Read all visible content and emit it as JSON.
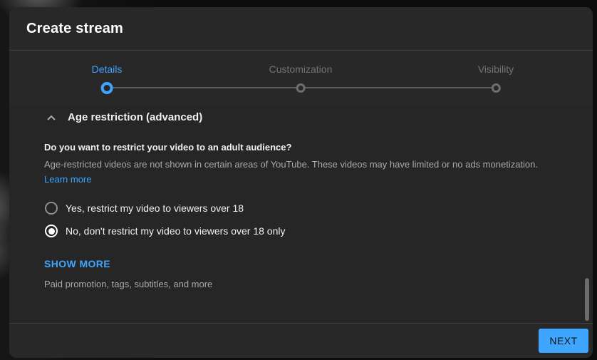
{
  "dialog": {
    "title": "Create stream",
    "stepper": {
      "steps": [
        {
          "label": "Details",
          "state": "active"
        },
        {
          "label": "Customization",
          "state": "inactive"
        },
        {
          "label": "Visibility",
          "state": "inactive"
        }
      ]
    },
    "section": {
      "title": "Age restriction (advanced)",
      "collapse_icon": "chevron-up-icon",
      "question": "Do you want to restrict your video to an adult audience?",
      "description": "Age-restricted videos are not shown in certain areas of YouTube. These videos may have limited or no ads monetization.",
      "learn_more_label": "Learn more",
      "options": [
        {
          "label": "Yes, restrict my video to viewers over 18",
          "selected": false
        },
        {
          "label": "No, don't restrict my video to viewers over 18 only",
          "selected": true
        }
      ]
    },
    "show_more_label": "SHOW MORE",
    "show_more_hint": "Paid promotion, tags, subtitles, and more",
    "footer": {
      "next_label": "NEXT"
    },
    "colors": {
      "accent": "#3ea6ff",
      "dialog_bg": "#282828",
      "content_bg": "#262626",
      "text_primary": "#f1f1f1",
      "text_secondary": "#a9a9a9",
      "divider": "#3f3f3f"
    }
  }
}
